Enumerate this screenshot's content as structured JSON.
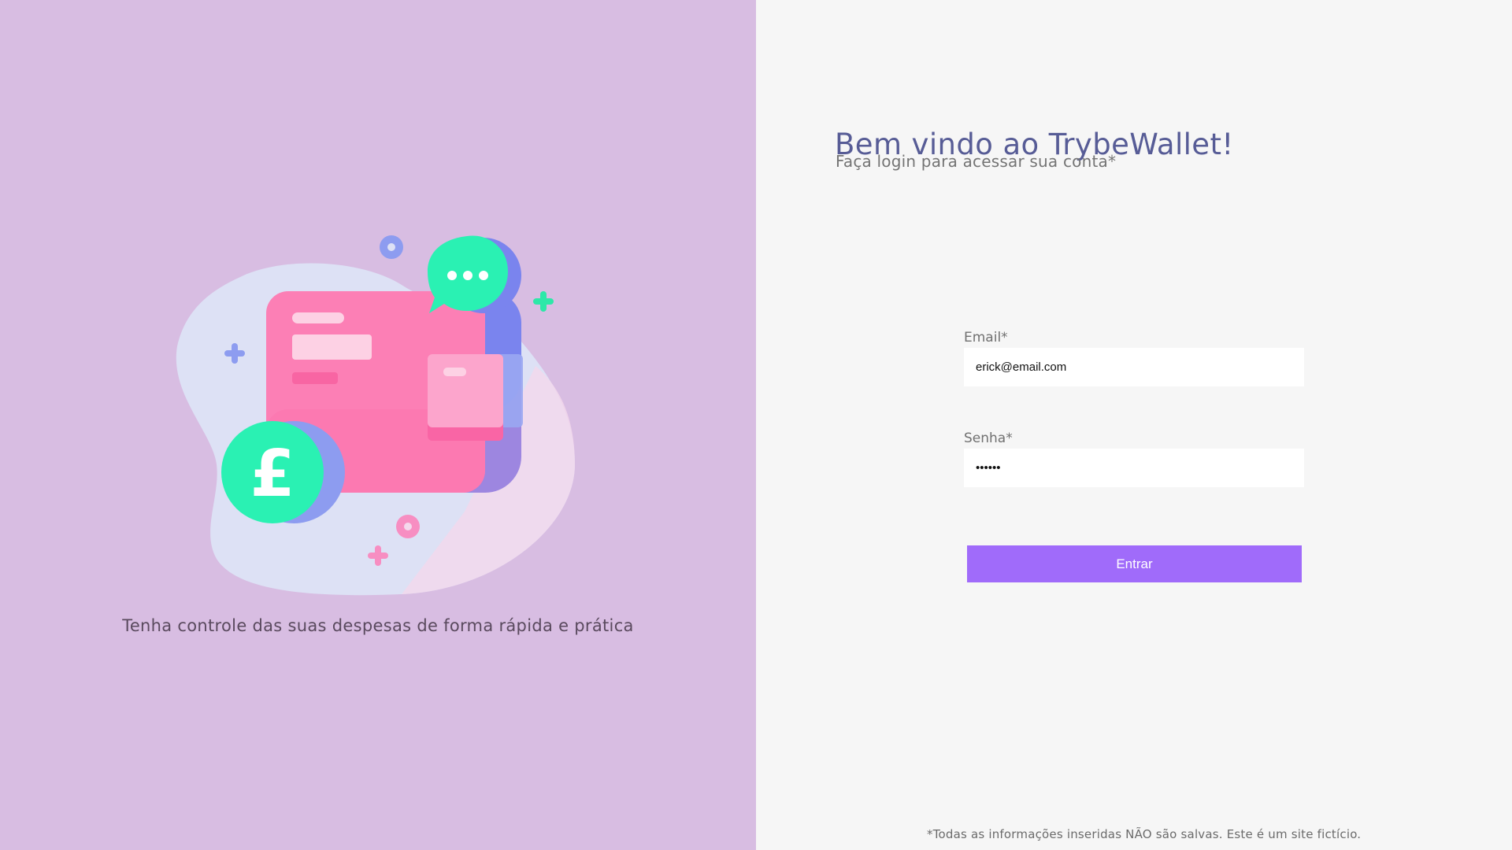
{
  "left": {
    "tagline": "Tenha controle das suas despesas de forma rápida e prática",
    "illustration": {
      "icon": "wallet-illustration",
      "currency_glyph": "£"
    }
  },
  "right": {
    "title": "Bem vindo ao TrybeWallet!",
    "subtitle": "Faça login para acessar sua conta*",
    "email": {
      "label": "Email*",
      "value": "erick@email.com"
    },
    "password": {
      "label": "Senha*",
      "value": "••••••"
    },
    "login_button": "Entrar",
    "disclaimer": "*Todas as informações inseridas NÃO são salvas. Este é um site fictício."
  },
  "colors": {
    "left_background": "#d8bde2",
    "right_background": "#f6f6f6",
    "title": "#575c96",
    "button": "#a06bfa"
  }
}
